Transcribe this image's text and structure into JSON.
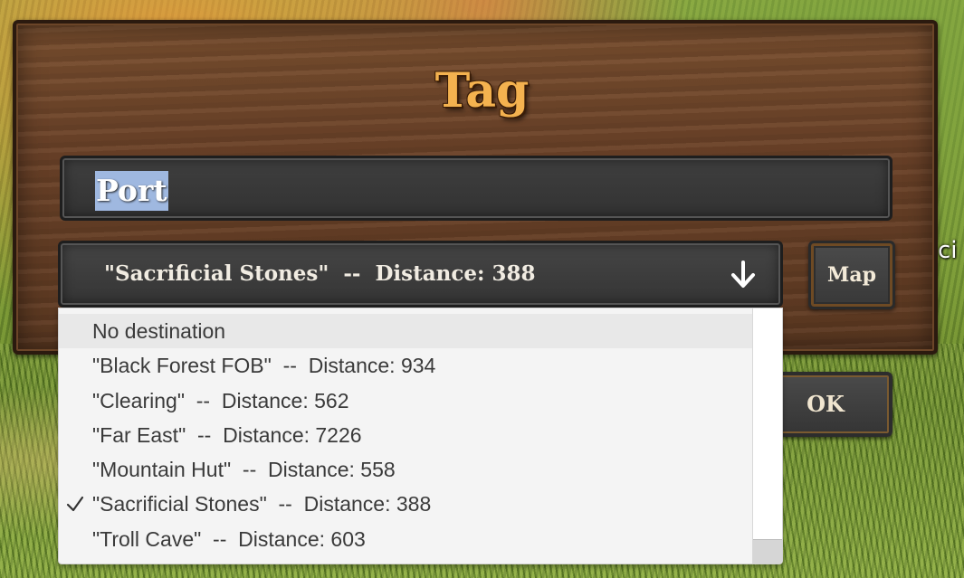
{
  "dialog": {
    "title": "Tag",
    "name_value": "Port",
    "selected_destination": "\"Sacrificial Stones\"  --  Distance: 388",
    "map_label": "Map",
    "ok_label": "OK"
  },
  "background": {
    "side_text": "ci"
  },
  "dropdown": {
    "items": [
      {
        "label": "No destination",
        "checked": false
      },
      {
        "label": "\"Black Forest FOB\"  --  Distance: 934",
        "checked": false
      },
      {
        "label": "\"Clearing\"  --  Distance: 562",
        "checked": false
      },
      {
        "label": "\"Far East\"  --  Distance: 7226",
        "checked": false
      },
      {
        "label": "\"Mountain Hut\"  --  Distance: 558",
        "checked": false
      },
      {
        "label": "\"Sacrificial Stones\"  --  Distance: 388",
        "checked": true
      },
      {
        "label": "\"Troll Cave\"  --  Distance: 603",
        "checked": false
      }
    ]
  },
  "colors": {
    "title": "#f4b24f",
    "panel_wood": "#6b4228",
    "selection_highlight": "#9fb8e0",
    "dropdown_bg": "#f4f4f4"
  },
  "icons": {
    "dropdown_arrow": "arrow-down-icon",
    "selected_marker": "check-icon"
  }
}
